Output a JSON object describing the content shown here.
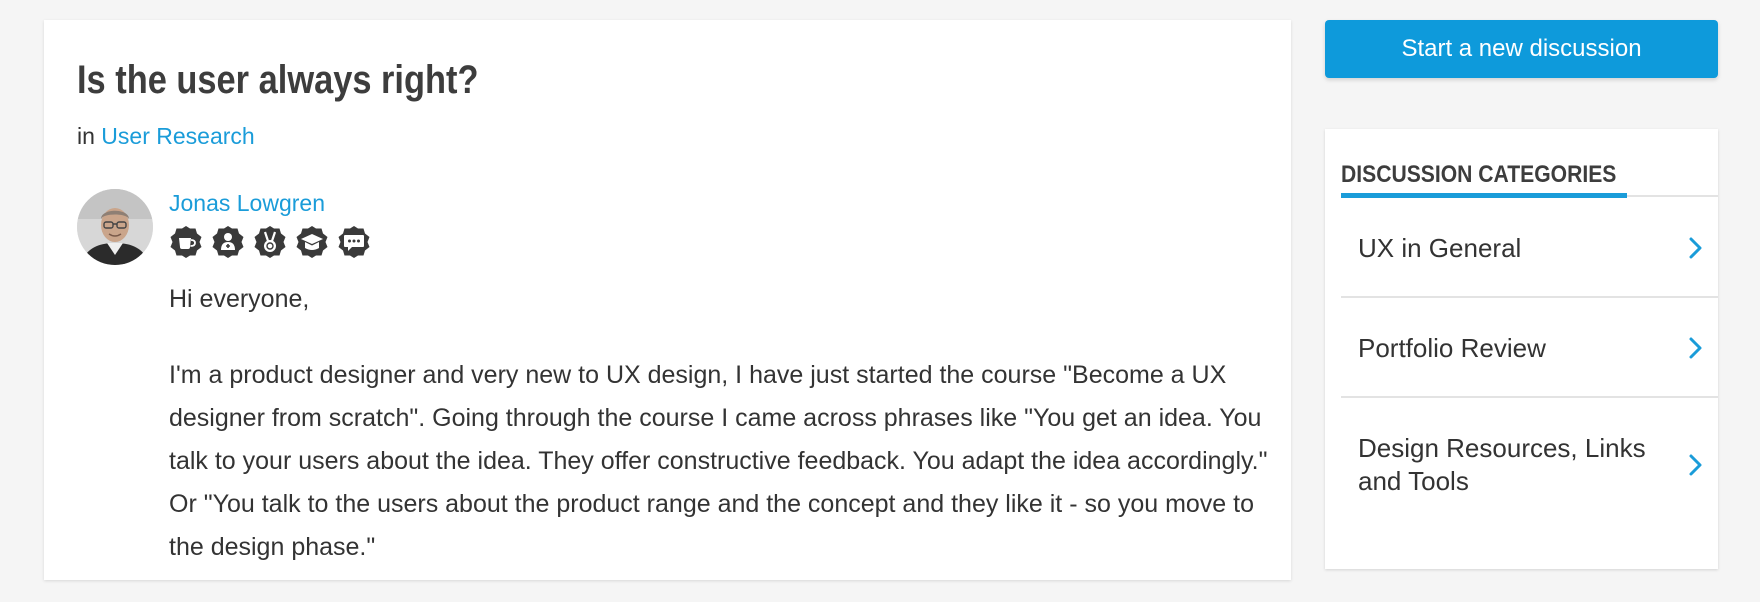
{
  "post": {
    "title": "Is the user always right?",
    "category_prefix": "in",
    "category_link": "User Research",
    "author": {
      "name": "Jonas Lowgren",
      "badges": [
        "coffee-cup-badge-icon",
        "user-plus-badge-icon",
        "medal-badge-icon",
        "graduation-cap-badge-icon",
        "chat-bubble-badge-icon"
      ]
    },
    "body": {
      "greeting": "Hi everyone,",
      "paragraph1": "I'm a product designer and very new to UX design, I have just started the course \"Become a UX designer from scratch\". Going through the course I came across phrases like \"You get an idea. You talk to your users about the idea. They offer constructive feedback. You adapt the idea accordingly.\" Or \"You talk to the users about the product range and the concept and they like it - so you move to the design phase.\""
    }
  },
  "sidebar": {
    "new_discussion_label": "Start a new discussion",
    "categories_title": "DISCUSSION CATEGORIES",
    "categories": [
      {
        "label": "UX in General"
      },
      {
        "label": "Portfolio Review"
      },
      {
        "label": "Design Resources, Links and Tools"
      }
    ]
  },
  "colors": {
    "accent": "#1a9cd9",
    "button": "#0e9adb",
    "badge": "#3a3a3a",
    "background": "#f5f5f5"
  }
}
